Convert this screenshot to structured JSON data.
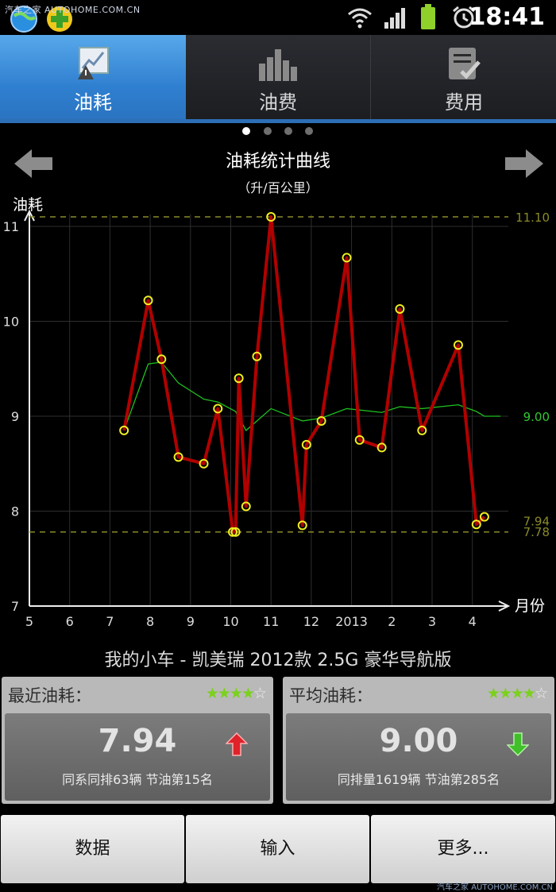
{
  "status_bar": {
    "watermark": "汽车之家 AUTOHOME.COM.CN",
    "time": "18:41",
    "icons": [
      "browser-globe-icon",
      "add-app-icon",
      "wifi-icon",
      "signal-icon",
      "battery-icon",
      "alarm-clock-icon"
    ]
  },
  "tabs": [
    {
      "label": "油耗",
      "icon": "fuel-chart-icon",
      "selected": true
    },
    {
      "label": "油费",
      "icon": "bar-chart-icon",
      "selected": false
    },
    {
      "label": "费用",
      "icon": "checklist-icon",
      "selected": false
    }
  ],
  "page_indicator": {
    "count": 4,
    "active": 0
  },
  "nav": {
    "prev_icon": "arrow-left-icon",
    "next_icon": "arrow-right-icon"
  },
  "chart_data": {
    "type": "line",
    "title": "油耗统计曲线",
    "subtitle": "（升/百公里）",
    "ylabel": "油耗",
    "xlabel": "月份",
    "x_ticks": [
      "5",
      "6",
      "7",
      "8",
      "9",
      "10",
      "11",
      "12",
      "2013",
      "2",
      "3",
      "4"
    ],
    "y_ticks": [
      "7",
      "8",
      "9",
      "10",
      "11"
    ],
    "ylim": [
      7,
      11.15
    ],
    "grid": true,
    "series": [
      {
        "color": "#b20000",
        "marker": "circle",
        "x": [
          7.35,
          7.95,
          8.28,
          8.7,
          9.33,
          9.68,
          10.05,
          10.12,
          10.2,
          10.38,
          10.65,
          11.0,
          11.78,
          11.88,
          12.25,
          12.88,
          13.2,
          13.75,
          14.2,
          14.75,
          15.65,
          16.1,
          16.3
        ],
        "values": [
          8.85,
          10.22,
          9.6,
          8.57,
          8.5,
          9.08,
          7.78,
          7.78,
          9.4,
          8.05,
          9.63,
          11.1,
          7.85,
          8.7,
          8.95,
          10.67,
          8.75,
          8.67,
          10.13,
          8.85,
          9.75,
          7.86,
          7.94
        ]
      },
      {
        "color": "#1ec01e",
        "x": [
          7.35,
          7.95,
          8.28,
          8.7,
          9.33,
          9.68,
          10.12,
          10.38,
          11.0,
          11.78,
          12.25,
          12.88,
          13.75,
          14.2,
          14.75,
          15.65,
          16.1,
          16.3,
          16.7
        ],
        "values": [
          8.85,
          9.55,
          9.57,
          9.35,
          9.18,
          9.15,
          9.05,
          8.85,
          9.08,
          8.95,
          8.98,
          9.08,
          9.04,
          9.1,
          9.08,
          9.12,
          9.05,
          9.0,
          9.0
        ]
      }
    ],
    "reference_lines": [
      {
        "label": "11.10",
        "value": 11.1,
        "style": "dashed",
        "color": "#8a8a2a"
      },
      {
        "label": "9.00",
        "value": 9.0,
        "style": "solid-label",
        "color": "#32c832"
      },
      {
        "label": "7.94",
        "value": 7.94,
        "style": "label-only",
        "color": "#8a8a2a"
      },
      {
        "label": "7.78",
        "value": 7.78,
        "style": "dashed",
        "color": "#8a8a2a"
      }
    ]
  },
  "car_title": "我的小车 - 凯美瑞  2012款 2.5G 豪华导航版",
  "cards": [
    {
      "title": "最近油耗：",
      "rating": 4,
      "rating_max": 5,
      "value": "7.94",
      "trend": "up",
      "trend_color": "#e0222a",
      "note": "同系同排63辆  节油第15名"
    },
    {
      "title": "平均油耗：",
      "rating": 4,
      "rating_max": 5,
      "value": "9.00",
      "trend": "down",
      "trend_color": "#3fbf2a",
      "note": "同排量1619辆  节油第285名"
    }
  ],
  "buttons": [
    {
      "label": "数据"
    },
    {
      "label": "输入"
    },
    {
      "label": "更多..."
    }
  ],
  "watermark_bottom": "汽车之家 AUTOHOME.COM.CN"
}
